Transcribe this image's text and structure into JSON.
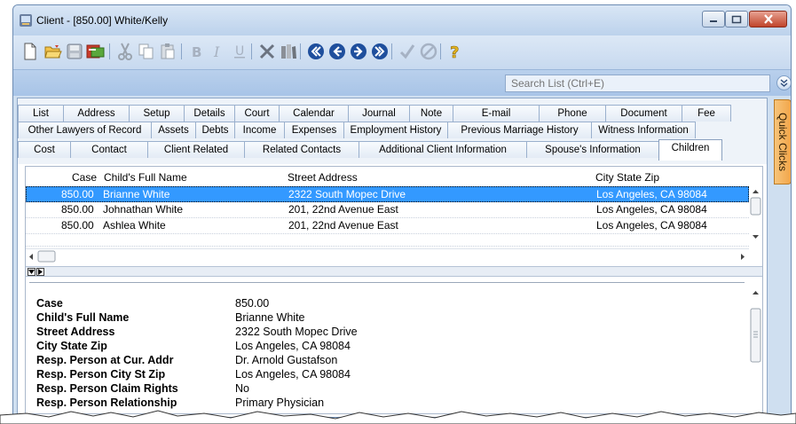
{
  "window": {
    "title": "Client - [850.00] White/Kelly"
  },
  "toolbar": {
    "buttons": [
      "new-icon",
      "open-icon",
      "save-icon",
      "export-icon",
      "cut-icon",
      "copy-icon",
      "paste-icon",
      "bold-icon",
      "italic-icon",
      "underline-icon",
      "tools-icon",
      "library-icon",
      "first-icon",
      "previous-icon",
      "next-icon",
      "last-icon",
      "check-icon",
      "cancel-icon",
      "help-icon"
    ]
  },
  "search": {
    "placeholder": "Search List (Ctrl+E)"
  },
  "quick_clicks": "Quick Clicks",
  "tabs": {
    "row1": [
      "List",
      "Address",
      "Setup",
      "Details",
      "Court",
      "Calendar",
      "Journal",
      "Note",
      "E-mail",
      "Phone",
      "Document",
      "Fee"
    ],
    "row2": [
      "Other Lawyers of Record",
      "Assets",
      "Debts",
      "Income",
      "Expenses",
      "Employment History",
      "Previous Marriage History",
      "Witness Information"
    ],
    "row3": [
      "Cost",
      "Contact",
      "Client Related",
      "Related Contacts",
      "Additional Client Information",
      "Spouse's Information",
      "Children"
    ],
    "active": "Children"
  },
  "grid": {
    "columns": [
      "Case",
      "Child's Full Name",
      "Street Address",
      "City State Zip"
    ],
    "rows": [
      [
        "850.00",
        "Brianne White",
        "2322 South Mopec Drive",
        "Los Angeles, CA 98084"
      ],
      [
        "850.00",
        "Johnathan White",
        "201, 22nd Avenue East",
        "Los Angeles, CA 98084"
      ],
      [
        "850.00",
        "Ashlea White",
        "201, 22nd Avenue East",
        "Los Angeles, CA 98084"
      ]
    ],
    "selected_row": 0
  },
  "detail": {
    "fields": [
      {
        "label": "Case",
        "value": "850.00"
      },
      {
        "label": "Child's Full Name",
        "value": "Brianne White"
      },
      {
        "label": "Street Address",
        "value": "2322 South Mopec Drive"
      },
      {
        "label": "City State Zip",
        "value": "Los Angeles, CA 98084"
      },
      {
        "label": "Resp. Person at Cur. Addr",
        "value": "Dr. Arnold Gustafson"
      },
      {
        "label": "Resp. Person City St Zip",
        "value": "Los Angeles, CA 98084"
      },
      {
        "label": "Resp. Person Claim Rights",
        "value": "No"
      },
      {
        "label": "Resp. Person Relationship",
        "value": "Primary Physician"
      }
    ]
  },
  "colors": {
    "selection": "#3399ff",
    "quick_clicks": "#f2a64a",
    "close_button": "#c0442a"
  }
}
